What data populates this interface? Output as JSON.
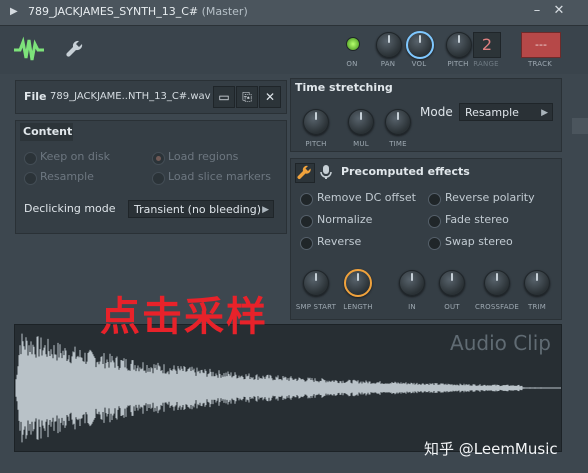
{
  "window": {
    "title": "789_JACKJAMES_SYNTH_13_C#",
    "subtitle": "(Master)"
  },
  "toolbar": {
    "on_label": "ON",
    "pan_label": "PAN",
    "vol_label": "VOL",
    "pitch_label": "PITCH",
    "range_label": "RANGE",
    "range_value": "2",
    "track_label": "TRACK",
    "track_value": "---"
  },
  "file": {
    "label": "File",
    "name": "789_JACKJAME..NTH_13_C#.wav"
  },
  "content": {
    "title": "Content",
    "options": [
      {
        "label": "Keep on disk",
        "checked": false
      },
      {
        "label": "Load regions",
        "checked": true
      },
      {
        "label": "Resample",
        "checked": false
      },
      {
        "label": "Load slice markers",
        "checked": false
      }
    ],
    "declicking_label": "Declicking mode",
    "declicking_value": "Transient (no bleeding)"
  },
  "time_stretching": {
    "title": "Time stretching",
    "knobs": [
      "PITCH",
      "MUL",
      "TIME"
    ],
    "mode_label": "Mode",
    "mode_value": "Resample"
  },
  "precomputed": {
    "title": "Precomputed effects",
    "effects": [
      "Remove DC offset",
      "Reverse polarity",
      "Normalize",
      "Fade stereo",
      "Reverse",
      "Swap stereo"
    ],
    "knobs": [
      "SMP START",
      "LENGTH",
      "IN",
      "OUT",
      "CROSSFADE",
      "TRIM"
    ]
  },
  "waveform": {
    "watermark": "Audio Clip"
  },
  "overlay": {
    "annotation": "点击采样",
    "credit": "知乎 @LeemMusic"
  },
  "colors": {
    "accent_orange": "#f0a23c",
    "accent_blue": "#7fc8ff",
    "on_led": "#8fe04a",
    "annotation_red": "#e8222a",
    "track_red": "#b64848"
  }
}
